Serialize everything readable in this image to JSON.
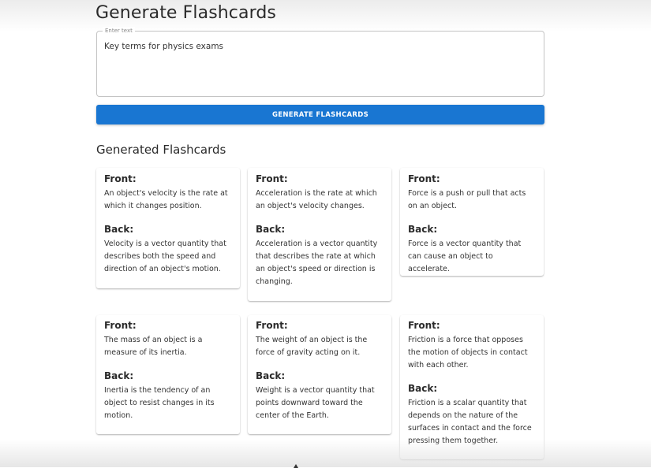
{
  "title": "Generate Flashcards",
  "input": {
    "label": "Enter text",
    "value": "Key terms for physics exams"
  },
  "button": {
    "label": "GENERATE FLASHCARDS"
  },
  "section_title": "Generated Flashcards",
  "front_label": "Front:",
  "back_label": "Back:",
  "cards": [
    {
      "front": "An object's velocity is the rate at which it changes position.",
      "back": "Velocity is a vector quantity that describes both the speed and direction of an object's motion."
    },
    {
      "front": "Acceleration is the rate at which an object's velocity changes.",
      "back": "Acceleration is a vector quantity that describes the rate at which an object's speed or direction is changing."
    },
    {
      "front": "Force is a push or pull that acts on an object.",
      "back": "Force is a vector quantity that can cause an object to accelerate."
    },
    {
      "front": "The mass of an object is a measure of its inertia.",
      "back": "Inertia is the tendency of an object to resist changes in its motion."
    },
    {
      "front": "The weight of an object is the force of gravity acting on it.",
      "back": "Weight is a vector quantity that points downward toward the center of the Earth."
    },
    {
      "front": "Friction is a force that opposes the motion of objects in contact with each other.",
      "back": "Friction is a scalar quantity that depends on the nature of the surfaces in contact and the force pressing them together."
    }
  ],
  "colors": {
    "primary": "#1976d2",
    "text": "#2a2a2a"
  }
}
